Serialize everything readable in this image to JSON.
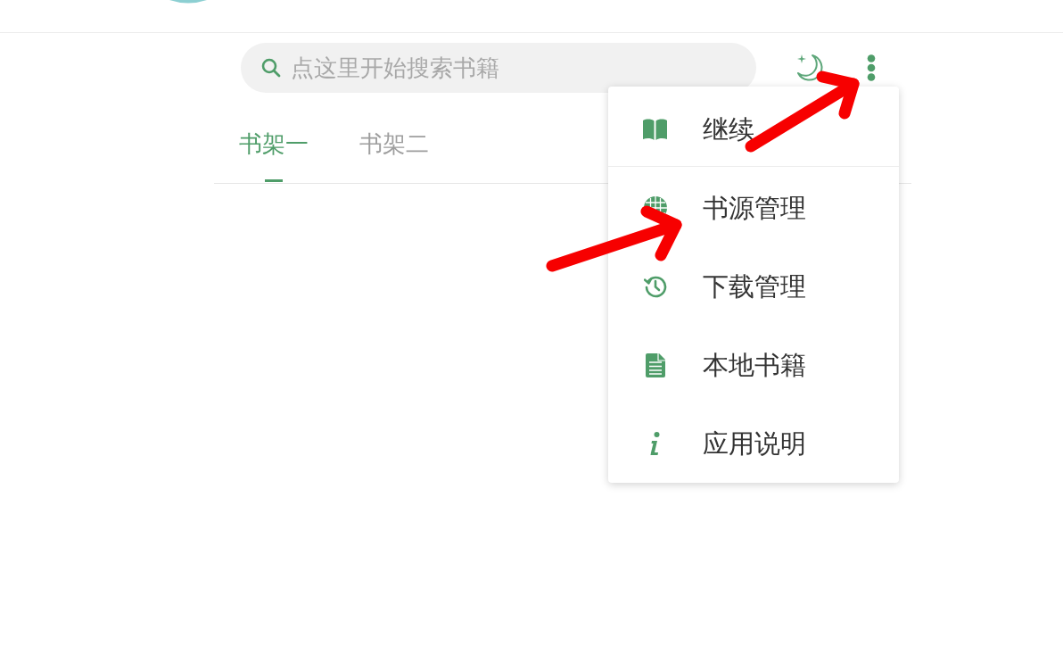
{
  "search": {
    "placeholder": "点这里开始搜索书籍"
  },
  "tabs": [
    {
      "label": "书架一",
      "selected": true
    },
    {
      "label": "书架二",
      "selected": false
    }
  ],
  "menu": {
    "groups": [
      {
        "items": [
          "继续"
        ]
      },
      {
        "items": [
          "书源管理",
          "下载管理",
          "本地书籍",
          "应用说明"
        ]
      }
    ]
  }
}
